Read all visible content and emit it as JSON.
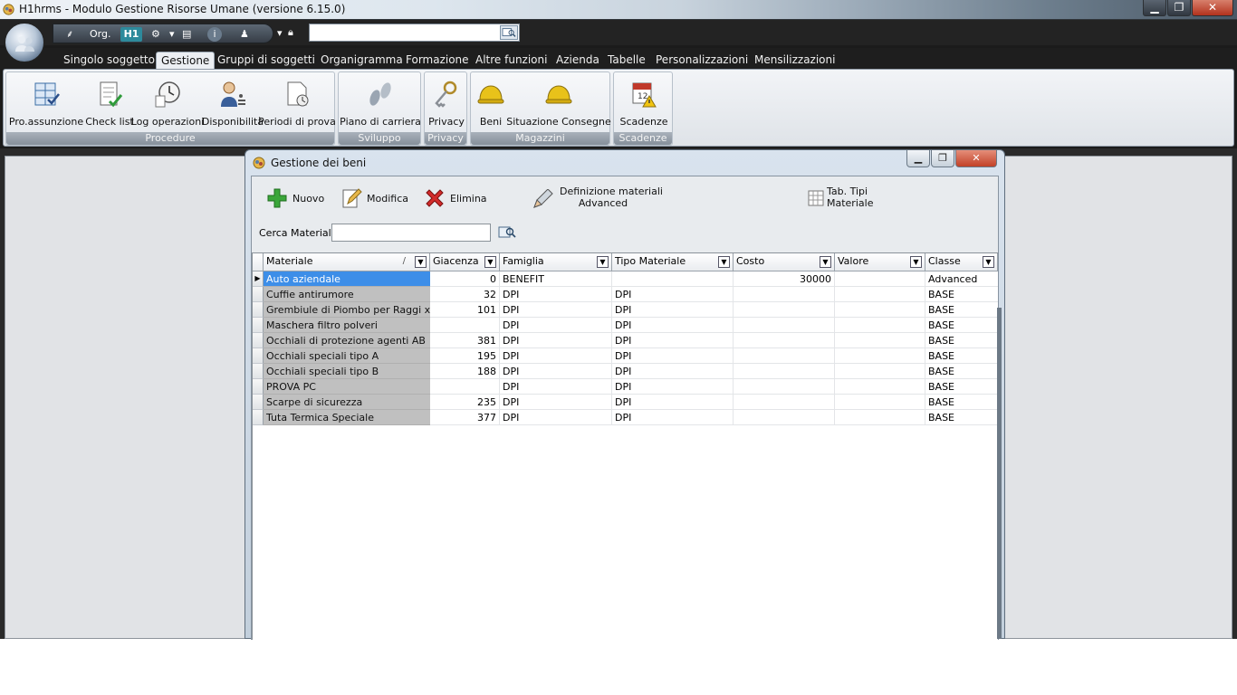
{
  "window": {
    "title": "H1hrms - Modulo Gestione Risorse Umane (versione 6.15.0)",
    "controls": [
      "minimize",
      "maximize",
      "close"
    ]
  },
  "quick_access": {
    "org_label": "Org.",
    "search_value": ""
  },
  "ribbon": {
    "tabs": [
      {
        "label": "Singolo soggetto",
        "active": false
      },
      {
        "label": "Gestione",
        "active": true
      },
      {
        "label": "Gruppi di soggetti",
        "active": false
      },
      {
        "label": "Organigramma",
        "active": false
      },
      {
        "label": "Formazione",
        "active": false
      },
      {
        "label": "Altre funzioni",
        "active": false
      },
      {
        "label": "Azienda",
        "active": false
      },
      {
        "label": "Tabelle",
        "active": false
      },
      {
        "label": "Personalizzazioni",
        "active": false
      },
      {
        "label": "Mensilizzazioni",
        "active": false
      }
    ],
    "groups": [
      {
        "label": "Procedure",
        "buttons": [
          "Pro.assunzione",
          "Check list",
          "Log operazioni",
          "Disponibilità",
          "Periodi di prova"
        ]
      },
      {
        "label": "Sviluppo",
        "buttons": [
          "Piano di carriera"
        ]
      },
      {
        "label": "Privacy",
        "buttons": [
          "Privacy"
        ]
      },
      {
        "label": "Magazzini",
        "buttons": [
          "Beni",
          "Situazione Consegne"
        ]
      },
      {
        "label": "Scadenze",
        "buttons": [
          "Scadenze"
        ]
      }
    ]
  },
  "child_window": {
    "title": "Gestione dei beni",
    "toolbar": {
      "new": "Nuovo",
      "edit": "Modifica",
      "delete": "Elimina",
      "definition_line1": "Definizione materiali",
      "definition_line2": "Advanced",
      "types_line1": "Tab. Tipi",
      "types_line2": "Materiale"
    },
    "search": {
      "label": "Cerca Materiale",
      "value": ""
    },
    "grid": {
      "columns": [
        "Materiale",
        "Giacenza",
        "Famiglia",
        "Tipo Materiale",
        "Costo",
        "Valore",
        "Classe"
      ],
      "sorted_column_marker": "/",
      "rows": [
        {
          "materiale": "Auto aziendale",
          "giacenza": "0",
          "famiglia": "BENEFIT",
          "tipo": "",
          "costo": "30000",
          "valore": "",
          "classe": "Advanced",
          "selected": true
        },
        {
          "materiale": "Cuffie antirumore",
          "giacenza": "32",
          "famiglia": "DPI",
          "tipo": "DPI",
          "costo": "",
          "valore": "",
          "classe": "BASE",
          "selected": false
        },
        {
          "materiale": "Grembiule di Piombo per Raggi x",
          "giacenza": "101",
          "famiglia": "DPI",
          "tipo": "DPI",
          "costo": "",
          "valore": "",
          "classe": "BASE",
          "selected": false
        },
        {
          "materiale": "Maschera filtro polveri",
          "giacenza": "",
          "famiglia": "DPI",
          "tipo": "DPI",
          "costo": "",
          "valore": "",
          "classe": "BASE",
          "selected": false
        },
        {
          "materiale": "Occhiali di protezione agenti AB",
          "giacenza": "381",
          "famiglia": "DPI",
          "tipo": "DPI",
          "costo": "",
          "valore": "",
          "classe": "BASE",
          "selected": false
        },
        {
          "materiale": "Occhiali speciali tipo A",
          "giacenza": "195",
          "famiglia": "DPI",
          "tipo": "DPI",
          "costo": "",
          "valore": "",
          "classe": "BASE",
          "selected": false
        },
        {
          "materiale": "Occhiali speciali tipo B",
          "giacenza": "188",
          "famiglia": "DPI",
          "tipo": "DPI",
          "costo": "",
          "valore": "",
          "classe": "BASE",
          "selected": false
        },
        {
          "materiale": "PROVA PC",
          "giacenza": "",
          "famiglia": "DPI",
          "tipo": "DPI",
          "costo": "",
          "valore": "",
          "classe": "BASE",
          "selected": false
        },
        {
          "materiale": "Scarpe di sicurezza",
          "giacenza": "235",
          "famiglia": "DPI",
          "tipo": "DPI",
          "costo": "",
          "valore": "",
          "classe": "BASE",
          "selected": false
        },
        {
          "materiale": "Tuta Termica Speciale",
          "giacenza": "377",
          "famiglia": "DPI",
          "tipo": "DPI",
          "costo": "",
          "valore": "",
          "classe": "BASE",
          "selected": false
        }
      ]
    }
  },
  "colors": {
    "selection": "#3d8ee8",
    "ribbon_group_label": "#858f9a",
    "dark_chrome": "#1e1e1e"
  }
}
